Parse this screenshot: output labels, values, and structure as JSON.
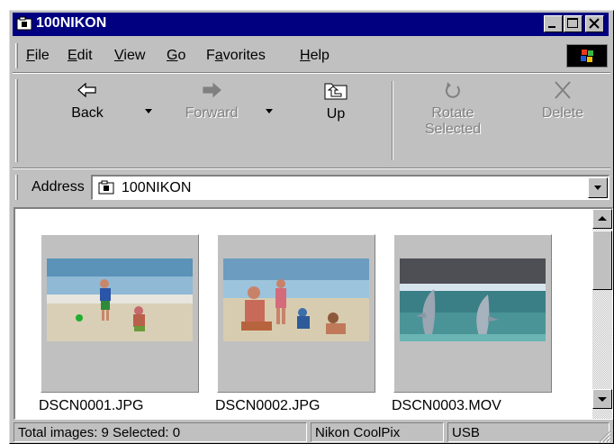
{
  "window": {
    "title": "100NIKON"
  },
  "menu": [
    {
      "label": "File",
      "mnemonic": "F",
      "rest": "ile"
    },
    {
      "label": "Edit",
      "mnemonic": "E",
      "rest": "dit"
    },
    {
      "label": "View",
      "mnemonic": "V",
      "rest": "iew"
    },
    {
      "label": "Go",
      "mnemonic": "G",
      "rest": "o"
    },
    {
      "label": "Favorites",
      "pre": "F",
      "mnemonic": "a",
      "rest": "vorites"
    },
    {
      "label": "Help",
      "mnemonic": "H",
      "rest": "elp"
    }
  ],
  "toolbar": {
    "back": {
      "label": "Back",
      "icon": "back-arrow-icon",
      "enabled": true
    },
    "forward": {
      "label": "Forward",
      "icon": "forward-arrow-icon",
      "enabled": false
    },
    "up": {
      "label": "Up",
      "icon": "up-folder-icon",
      "enabled": true
    },
    "rotate": {
      "line1": "Rotate",
      "line2": "Selected",
      "icon": "rotate-icon",
      "enabled": false
    },
    "delete": {
      "label": "Delete",
      "icon": "delete-x-icon",
      "enabled": false
    }
  },
  "address": {
    "label": "Address",
    "value": "100NIKON",
    "icon": "camera-folder-icon"
  },
  "files": [
    {
      "name": "DSCN0001.JPG",
      "scene": "children-on-beach"
    },
    {
      "name": "DSCN0002.JPG",
      "scene": "family-on-beach"
    },
    {
      "name": "DSCN0003.MOV",
      "scene": "dolphins-jumping"
    }
  ],
  "status": {
    "count": "Total images: 9   Selected: 0",
    "camera": "Nikon CoolPix",
    "connection": "USB"
  },
  "colors": {
    "titlebar": "#000080",
    "face": "#c0c0c0",
    "shadow": "#808080",
    "highlight": "#ffffff"
  }
}
